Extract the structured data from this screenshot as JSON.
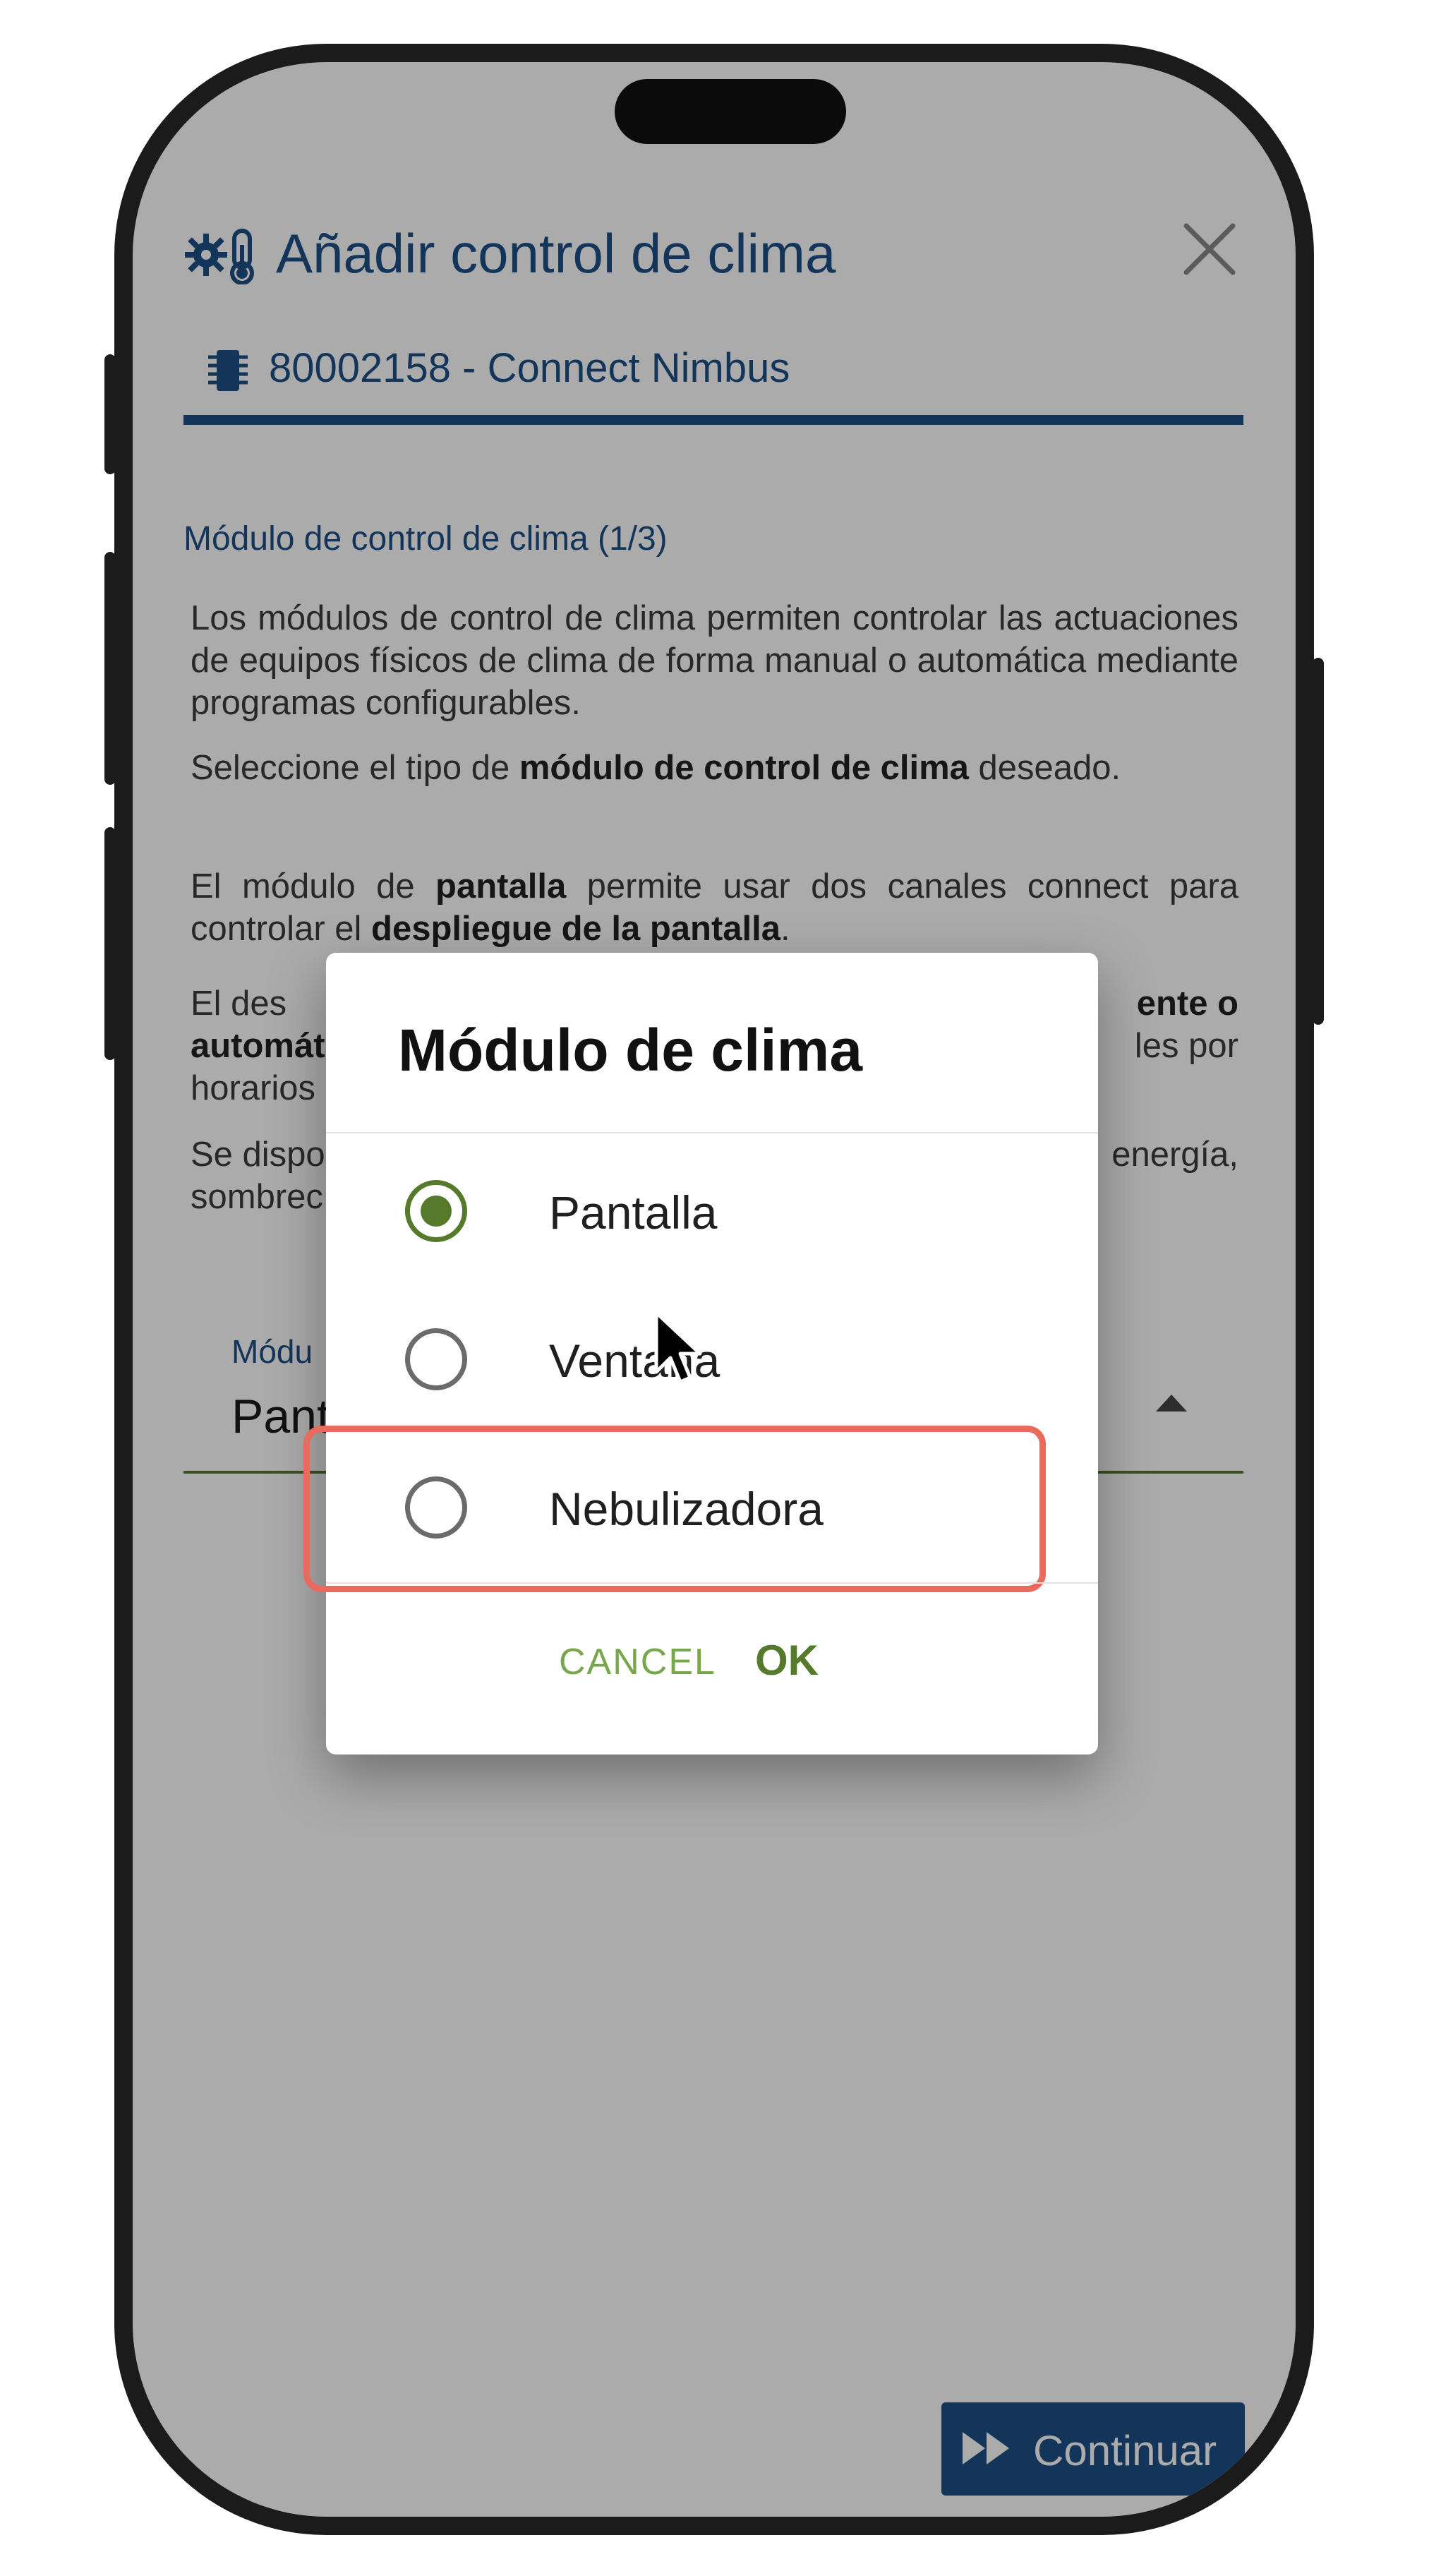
{
  "header": {
    "title": "Añadir control de clima",
    "device": "80002158 - Connect Nimbus"
  },
  "step": {
    "title": "Módulo de control de clima (1/3)"
  },
  "description": {
    "p1": "Los módulos de control de clima permiten controlar las actuaciones de equipos físicos de clima de forma manual o automática mediante programas configurables.",
    "p2_before": "Seleccione el tipo de ",
    "p2_bold": "módulo de control de clima",
    "p2_after": " deseado.",
    "p3_a": "El módulo de ",
    "p3_b": "pantalla",
    "p3_c": " permite usar dos canales connect para controlar el ",
    "p3_d": "despliegue de la pantalla",
    "p3_e": ".",
    "p4_a": "El des",
    "p4_b": "ente o",
    "p4_c": "automát",
    "p4_d": "les por",
    "p4_e": "horarios",
    "p5_a": "Se dispo",
    "p5_b": "energía,",
    "p5_c": "sombrec"
  },
  "field": {
    "label": "Módu",
    "value": "Pant"
  },
  "dialog": {
    "title": "Módulo de clima",
    "options": [
      {
        "label": "Pantalla",
        "selected": true
      },
      {
        "label": "Ventana",
        "selected": false
      },
      {
        "label": "Nebulizadora",
        "selected": false
      }
    ],
    "highlighted_option": "Nebulizadora",
    "cancel": "CANCEL",
    "ok": "OK"
  },
  "footer": {
    "continue": "Continuar"
  },
  "icons": {
    "header": "climate-gear-thermometer-icon",
    "device": "chip-icon",
    "close": "close-icon",
    "continue": "fast-forward-icon",
    "cursor": "mouse-pointer-icon"
  },
  "colors": {
    "primary": "#1d4f85",
    "accent_green": "#557a2c",
    "highlight": "#ea6a5e"
  }
}
